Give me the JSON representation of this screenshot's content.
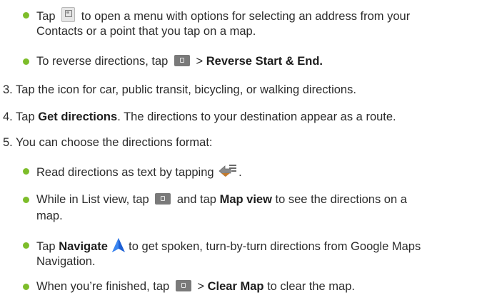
{
  "steps": {
    "b1_pre": "Tap",
    "b1_post": "to open a menu with options for selecting an address from your",
    "b1_cont": "Contacts or a point that you tap on a map.",
    "b2_pre": "To reverse directions, tap",
    "b2_sep": ">",
    "b2_bold": "Reverse Start & End.",
    "s3": "3. Tap the icon for car, public transit, bicycling, or walking directions.",
    "s4_pre": "4. Tap",
    "s4_bold": "Get directions",
    "s4_post": ". The directions to your destination appear as a route.",
    "s5": "5. You can choose the directions format:",
    "c1_pre": "Read directions as text by tapping",
    "c1_post": ".",
    "c2_pre": "While in List view, tap",
    "c2_mid": "and tap",
    "c2_bold": "Map view",
    "c2_post": "to see the directions on a",
    "c2_cont": "map.",
    "c3_pre": "Tap",
    "c3_bold": "Navigate",
    "c3_post": "to get spoken, turn-by-turn directions from Google Maps",
    "c3_cont": "Navigation.",
    "c4_pre": "When you’re finished, tap",
    "c4_sep": ">",
    "c4_bold": "Clear Map",
    "c4_post": "to clear the map."
  },
  "icons": {
    "contact": "contact-picker-icon",
    "menu": "menu-key-icon",
    "directions_list": "directions-list-icon",
    "navigate": "navigate-arrow-icon"
  },
  "colors": {
    "bullet": "#7dbd2a",
    "navigate": "#1c5fd4"
  }
}
